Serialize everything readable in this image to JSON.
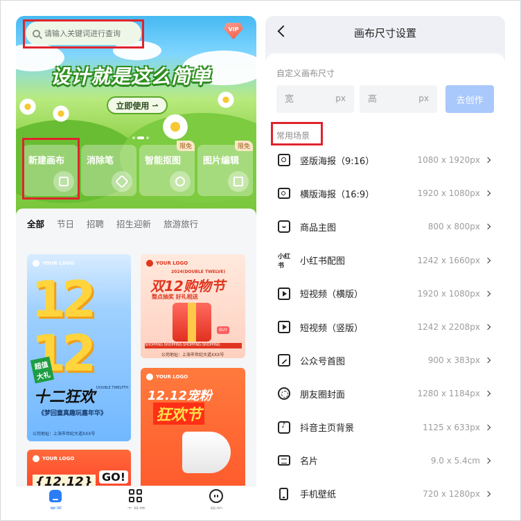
{
  "left": {
    "search": {
      "placeholder": "请输入关键词进行查询",
      "icon": "search-icon"
    },
    "vip_badge": "VIP",
    "banner": {
      "slogan": "设计就是这么简单",
      "button": "立即使用",
      "button_arrow": "⇀"
    },
    "tools": [
      {
        "label": "新建画布",
        "icon": "new-canvas-icon",
        "tag": ""
      },
      {
        "label": "消除笔",
        "icon": "eraser-icon",
        "tag": ""
      },
      {
        "label": "智能抠图",
        "icon": "cutout-icon",
        "tag": "限免"
      },
      {
        "label": "图片编辑",
        "icon": "crop-icon",
        "tag": "限免"
      }
    ],
    "categories": [
      "全部",
      "节日",
      "招聘",
      "招生迎新",
      "旅游旅行"
    ],
    "active_category": "全部",
    "templates": {
      "logo_text": "YOUR LOGO",
      "t1": {
        "number": "12\n12",
        "badge": "超值\n大礼",
        "headline": "十二狂欢",
        "english": "DOUBLE TWELFTH",
        "sub": "《梦回童真趣玩嘉年华》",
        "address": "公司地址：上海市世纪大道XXX号"
      },
      "t2": {
        "english": "2024(DOUBLE TWELVE)",
        "title": "双12购物节",
        "sub": "整点抽奖 好礼相送",
        "strip": "SHOPPING·SHOPPING·SHOPPING·SHOPPING",
        "address": "公司地址：上海市世纪大道XXX号",
        "buy": "BUY"
      },
      "t3": {
        "title": "12.12宠粉",
        "title2": "狂欢节"
      },
      "t4": {
        "title": "{12.12}",
        "go": "GO!"
      }
    },
    "tabbar": [
      {
        "label": "首页",
        "icon": "home-icon",
        "active": true
      },
      {
        "label": "工具箱",
        "icon": "grid-icon",
        "active": false
      },
      {
        "label": "我的",
        "icon": "profile-icon",
        "active": false
      }
    ]
  },
  "right": {
    "title": "画布尺寸设置",
    "custom_label": "自定义画布尺寸",
    "width_placeholder": "宽",
    "height_placeholder": "高",
    "unit": "px",
    "create_button": "去创作",
    "common_label": "常用场景",
    "scenes": [
      {
        "name": "竖版海报（9:16）",
        "size": "1080 x 1920px",
        "icon": "poster-vertical-icon",
        "cls": "i-poster-v"
      },
      {
        "name": "横版海报（16:9）",
        "size": "1920 x 1080px",
        "icon": "poster-horizontal-icon",
        "cls": "i-poster-h"
      },
      {
        "name": "商品主图",
        "size": "800 x 800px",
        "icon": "product-icon",
        "cls": "i-product"
      },
      {
        "name": "小红书配图",
        "size": "1242 x 1660px",
        "icon": "xiaohongshu-icon",
        "cls": "i-xhs"
      },
      {
        "name": "短视频（横版）",
        "size": "1920 x 1080px",
        "icon": "video-icon",
        "cls": "i-video"
      },
      {
        "name": "短视频（竖版）",
        "size": "1242 x 2208px",
        "icon": "video-icon",
        "cls": "i-video"
      },
      {
        "name": "公众号首图",
        "size": "900 x 383px",
        "icon": "image-icon",
        "cls": "i-image"
      },
      {
        "name": "朋友圈封面",
        "size": "1280 x 1184px",
        "icon": "moments-icon",
        "cls": "i-moments"
      },
      {
        "name": "抖音主页背景",
        "size": "1125 x 633px",
        "icon": "douyin-icon",
        "cls": "i-douyin"
      },
      {
        "name": "名片",
        "size": "9.0 x 5.4cm",
        "icon": "business-card-icon",
        "cls": "i-card"
      },
      {
        "name": "手机壁纸",
        "size": "720 x 1280px",
        "icon": "phone-icon",
        "cls": "i-phone"
      }
    ],
    "xhs_icon_text": "小红书"
  },
  "colors": {
    "accent_blue": "#2a7df6",
    "create_button": "#a9c8fb",
    "annotation_red": "#e0232c",
    "banner_green": "#75c43a"
  }
}
